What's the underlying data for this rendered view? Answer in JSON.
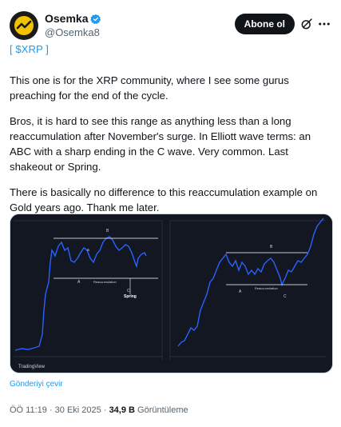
{
  "author": {
    "display_name": "Osemka",
    "handle": "@Osemka8",
    "verified": true
  },
  "actions": {
    "follow_label": "Abone ol"
  },
  "tweet": {
    "cashtag_line": {
      "open": "[ ",
      "cashtag": "$XRP",
      "close": " ]"
    },
    "paragraphs": [
      "This one is for the XRP community, where I see some gurus preaching for the end of the cycle.",
      "Bros, it is hard to see this range as anything less than a long reaccumulation after November's surge. In Elliott wave terms: an ABC with a sharp ending in the C wave. Very common. Last shakeout or Spring.",
      "There is basically no difference to this reaccumulation example on Gold years ago. Thank me later."
    ]
  },
  "media": {
    "left_chart": {
      "labels": {
        "a": "a",
        "b": "B",
        "c": "C",
        "big_a": "A",
        "range": "Reaccumulation",
        "spring": "Spring"
      }
    },
    "right_chart": {
      "labels": {
        "b": "B",
        "a": "A",
        "c": "C",
        "range": "Reaccumulation"
      }
    },
    "watermark": "TradingView"
  },
  "translate_label": "Gönderiyi çevir",
  "meta": {
    "time": "ÖÖ 11:19",
    "separator": " · ",
    "date": "30 Eki 2025",
    "views_count": "34,9 B",
    "views_label": " Görüntüleme"
  },
  "colors": {
    "accent": "#1d9bf0",
    "chart_bg": "#131722",
    "chart_line": "#2962ff",
    "range_line": "#ffffff"
  },
  "icons": {
    "verified": "verified-badge-icon",
    "grok": "grok-icon",
    "more": "more-icon"
  }
}
